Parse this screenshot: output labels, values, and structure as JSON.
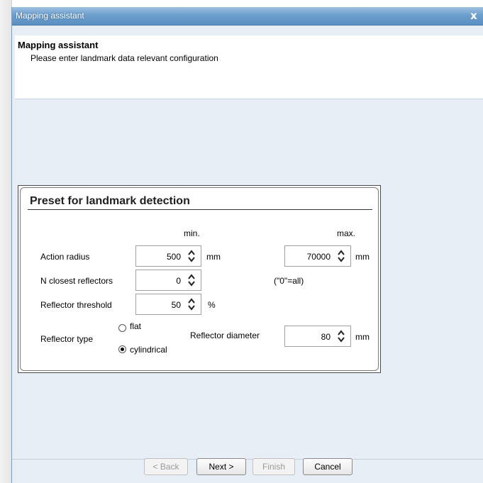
{
  "window": {
    "title": "Mapping assistant",
    "close_glyph": "x"
  },
  "header": {
    "title": "Mapping assistant",
    "subtitle": "Please enter landmark data relevant configuration"
  },
  "landmark": {
    "title": "Preset for landmark detection",
    "col_min": "min.",
    "col_max": "max.",
    "action_radius": {
      "label": "Action radius",
      "min_value": "500",
      "min_unit": "mm",
      "max_value": "70000",
      "max_unit": "mm"
    },
    "n_closest": {
      "label": "N closest reflectors",
      "value": "0",
      "note": "(\"0\"=all)"
    },
    "threshold": {
      "label": "Reflector threshold",
      "value": "50",
      "unit": "%"
    },
    "reflector_type": {
      "label": "Reflector type",
      "options": [
        "flat",
        "cylindrical"
      ],
      "selected": "cylindrical"
    },
    "diameter": {
      "label": "Reflector diameter",
      "value": "80",
      "unit": "mm"
    }
  },
  "footer": {
    "back": "< Back",
    "next": "Next >",
    "finish": "Finish",
    "cancel": "Cancel"
  }
}
